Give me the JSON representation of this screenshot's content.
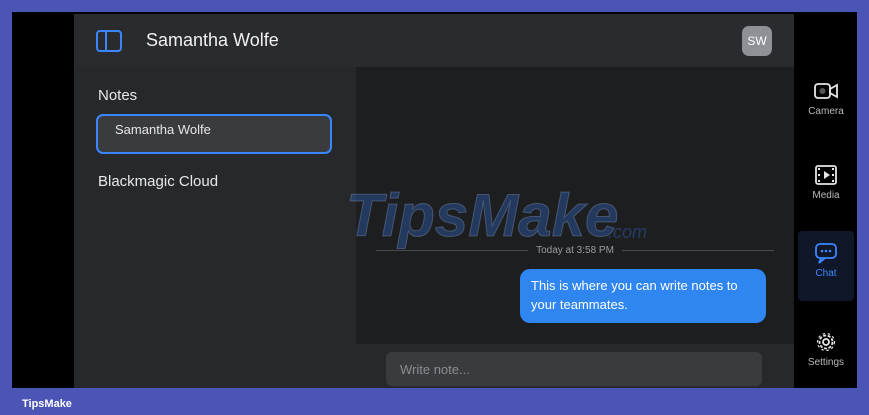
{
  "header": {
    "title": "Samantha Wolfe",
    "avatar_initials": "SW"
  },
  "notes_panel": {
    "heading": "Notes",
    "items": [
      {
        "label": "Samantha Wolfe",
        "selected": true
      },
      {
        "label": "Blackmagic Cloud",
        "selected": false
      }
    ]
  },
  "chat": {
    "timestamp": "Today at 3:58 PM",
    "messages": [
      {
        "text": "This is where you can write notes to your teammates."
      }
    ],
    "input_placeholder": "Write note..."
  },
  "rail": {
    "items": [
      {
        "label": "Camera",
        "icon": "camera-icon"
      },
      {
        "label": "Media",
        "icon": "media-icon"
      },
      {
        "label": "Chat",
        "icon": "chat-icon",
        "active": true
      },
      {
        "label": "Settings",
        "icon": "gear-icon"
      }
    ]
  },
  "watermark": {
    "text_main": "TipsMake",
    "text_suffix": ".com"
  },
  "footer": {
    "brand": "TipsMake"
  },
  "colors": {
    "accent": "#3a86ff",
    "bubble": "#2f86f0",
    "border": "#4a55b5"
  }
}
